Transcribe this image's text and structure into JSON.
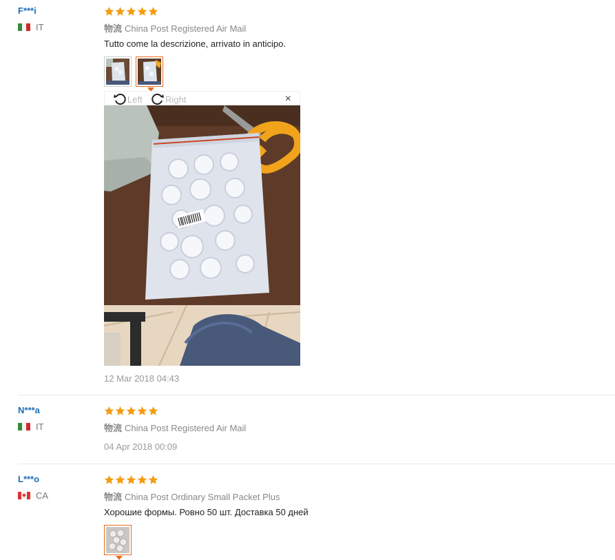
{
  "reviews": [
    {
      "user": "F***i",
      "country": "IT",
      "logistics_label": "物流",
      "logistics": "China Post Registered Air Mail",
      "text": "Tutto come la descrizione, arrivato in anticipo.",
      "date": "12 Mar 2018 04:43"
    },
    {
      "user": "N***a",
      "country": "IT",
      "logistics_label": "物流",
      "logistics": "China Post Registered Air Mail",
      "date": "04 Apr 2018 00:09"
    },
    {
      "user": "L***o",
      "country": "CA",
      "logistics_label": "物流",
      "logistics": "China Post Ordinary Small Packet Plus",
      "text": "Хорошие формы. Ровно 50 шт. Доставка 50 дней"
    }
  ],
  "rating": {
    "stars": 5,
    "star_color": "#f39c12"
  },
  "viewer": {
    "rotate_left_label": "Left",
    "rotate_right_label": "Right",
    "close_label": "×"
  },
  "colors": {
    "username": "#1a6fb8",
    "accent": "#e96a1e"
  }
}
